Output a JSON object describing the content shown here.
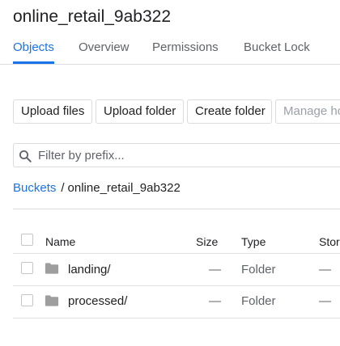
{
  "header": {
    "bucket_name": "online_retail_9ab322"
  },
  "tabs": [
    {
      "label": "Objects",
      "active": true
    },
    {
      "label": "Overview",
      "active": false
    },
    {
      "label": "Permissions",
      "active": false
    },
    {
      "label": "Bucket Lock",
      "active": false
    }
  ],
  "toolbar": {
    "upload_files": "Upload files",
    "upload_folder": "Upload folder",
    "create_folder": "Create folder",
    "manage_holds": "Manage ho"
  },
  "filter": {
    "placeholder": "Filter by prefix...",
    "icon": "search-icon"
  },
  "breadcrumb": {
    "root": "Buckets",
    "separator": "/",
    "current": "online_retail_9ab322"
  },
  "table": {
    "columns": [
      "Name",
      "Size",
      "Type",
      "Stor"
    ],
    "rows": [
      {
        "name": "landing/",
        "size": "—",
        "type": "Folder",
        "storage": "—",
        "icon": "folder-icon"
      },
      {
        "name": "processed/",
        "size": "—",
        "type": "Folder",
        "storage": "—",
        "icon": "folder-icon"
      }
    ]
  },
  "colors": {
    "accent": "#1a73e8",
    "text": "#202124",
    "muted": "#5f6368",
    "border": "#dadce0",
    "folder": "#9e9e9e"
  }
}
